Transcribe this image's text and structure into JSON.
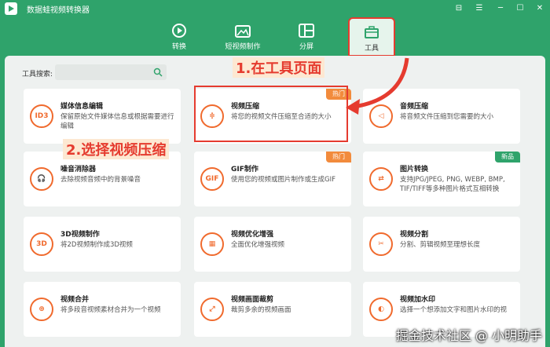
{
  "window": {
    "title": "数据蛙视频转换器",
    "controls": [
      "⊟",
      "☰",
      "─",
      "☐",
      "✕"
    ]
  },
  "nav": [
    {
      "label": "转换",
      "icon": "refresh-play-icon"
    },
    {
      "label": "短视频制作",
      "icon": "tv-image-icon"
    },
    {
      "label": "分屏",
      "icon": "split-screen-icon"
    },
    {
      "label": "工具",
      "icon": "toolbox-icon",
      "active": true
    }
  ],
  "search": {
    "label": "工具搜索:",
    "placeholder": ""
  },
  "cards": [
    {
      "title": "媒体信息编辑",
      "desc": "保留原始文件媒体信息或根据需要进行编辑",
      "icon_text": "ID3",
      "badge": ""
    },
    {
      "title": "视频压缩",
      "desc": "将您的视频文件压缩至合适的大小",
      "icon_text": "≑",
      "badge": "热门"
    },
    {
      "title": "音频压缩",
      "desc": "将音频文件压缩到您需要的大小",
      "icon_text": "◁",
      "badge": ""
    },
    {
      "title": "噪音消除器",
      "desc": "去除视频音频中的背景噪音",
      "icon_text": "🎧",
      "badge": ""
    },
    {
      "title": "GIF制作",
      "desc": "使用您的视频或图片制作或生成GIF",
      "icon_text": "GIF",
      "badge": "热门"
    },
    {
      "title": "图片转换",
      "desc": "支持JPG/JPEG, PNG, WEBP, BMP, TIF/TIFF等多种图片格式互相转换",
      "icon_text": "⇄",
      "badge": "新品"
    },
    {
      "title": "3D视频制作",
      "desc": "将2D视频制作成3D视频",
      "icon_text": "3D",
      "badge": ""
    },
    {
      "title": "视频优化增强",
      "desc": "全面优化增强视频",
      "icon_text": "▦",
      "badge": ""
    },
    {
      "title": "视频分割",
      "desc": "分割、剪辑视频至理想长度",
      "icon_text": "✂",
      "badge": ""
    },
    {
      "title": "视频合并",
      "desc": "将多段音视频素材合并为一个视频",
      "icon_text": "⊕",
      "badge": ""
    },
    {
      "title": "视频画面裁剪",
      "desc": "裁剪多余的视频画面",
      "icon_text": "⤢",
      "badge": ""
    },
    {
      "title": "视频加水印",
      "desc": "选择一个想添加文字和图片水印的视",
      "icon_text": "◐",
      "badge": ""
    }
  ],
  "annotations": {
    "step1": "1.在工具页面",
    "step2": "2.选择视频压缩"
  },
  "watermark": "掘金技术社区 @ 小明助手",
  "colors": {
    "brand_green": "#2fa36b",
    "accent_orange": "#f06a2d",
    "highlight_red": "#e53b2f"
  }
}
